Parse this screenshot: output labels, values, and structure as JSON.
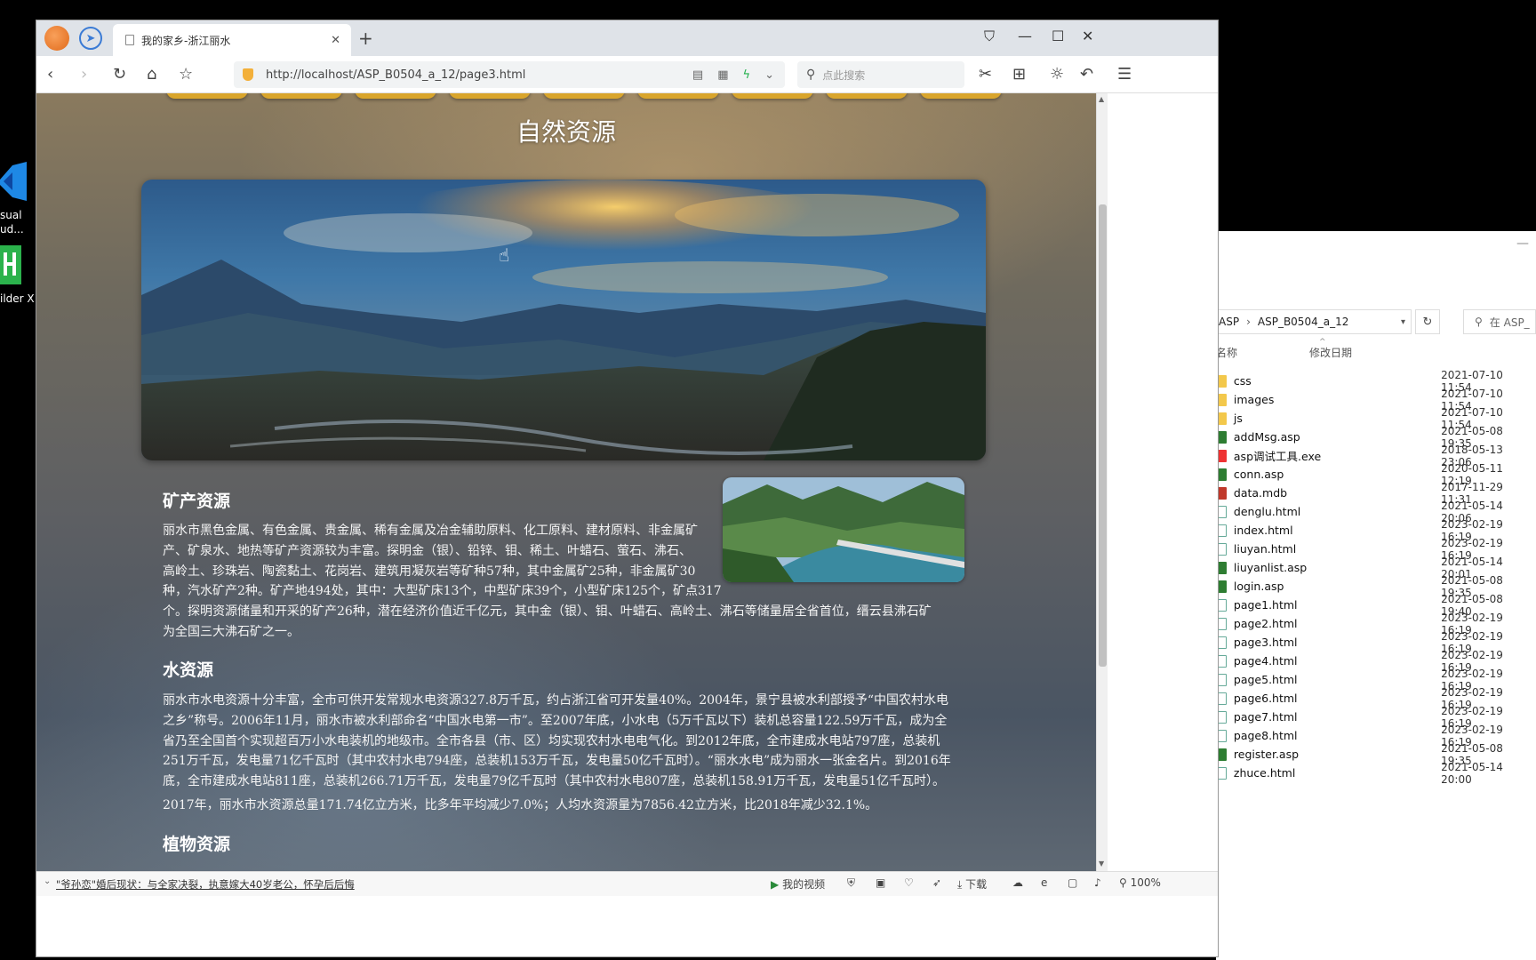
{
  "desktop": {
    "icons": [
      {
        "label_lines": [
          "sual",
          "ud..."
        ]
      },
      {
        "label_lines": [
          "ilder X"
        ]
      }
    ]
  },
  "explorer": {
    "path": [
      "ASP",
      "ASP_B0504_a_12"
    ],
    "search_placeholder": "在 ASP_",
    "col_name": "名称",
    "col_date": "修改日期",
    "files": [
      {
        "name": "css",
        "date": "2021-07-10 11:54",
        "type": "folder"
      },
      {
        "name": "images",
        "date": "2021-07-10 11:54",
        "type": "folder"
      },
      {
        "name": "js",
        "date": "2021-07-10 11:54",
        "type": "folder"
      },
      {
        "name": "addMsg.asp",
        "date": "2021-05-08 19:35",
        "type": "asp"
      },
      {
        "name": "asp调试工具.exe",
        "date": "2018-05-13 23:06",
        "type": "exe"
      },
      {
        "name": "conn.asp",
        "date": "2020-05-11 12:19",
        "type": "asp"
      },
      {
        "name": "data.mdb",
        "date": "2017-11-29 11:31",
        "type": "mdb"
      },
      {
        "name": "denglu.html",
        "date": "2021-05-14 20:06",
        "type": "html"
      },
      {
        "name": "index.html",
        "date": "2023-02-19 16:19",
        "type": "html"
      },
      {
        "name": "liuyan.html",
        "date": "2023-02-19 16:19",
        "type": "html"
      },
      {
        "name": "liuyanlist.asp",
        "date": "2021-05-14 20:01",
        "type": "asp"
      },
      {
        "name": "login.asp",
        "date": "2021-05-08 19:35",
        "type": "asp"
      },
      {
        "name": "page1.html",
        "date": "2021-05-08 19:40",
        "type": "html"
      },
      {
        "name": "page2.html",
        "date": "2023-02-19 16:19",
        "type": "html"
      },
      {
        "name": "page3.html",
        "date": "2023-02-19 16:19",
        "type": "html"
      },
      {
        "name": "page4.html",
        "date": "2023-02-19 16:19",
        "type": "html"
      },
      {
        "name": "page5.html",
        "date": "2023-02-19 16:19",
        "type": "html"
      },
      {
        "name": "page6.html",
        "date": "2023-02-19 16:19",
        "type": "html"
      },
      {
        "name": "page7.html",
        "date": "2023-02-19 16:19",
        "type": "html"
      },
      {
        "name": "page8.html",
        "date": "2023-02-19 16:19",
        "type": "html"
      },
      {
        "name": "register.asp",
        "date": "2021-05-08 19:35",
        "type": "asp"
      },
      {
        "name": "zhuce.html",
        "date": "2021-05-14 20:00",
        "type": "html"
      }
    ]
  },
  "browser": {
    "tab_title": "我的家乡-浙江丽水",
    "url": "http://localhost/ASP_B0504_a_12/page3.html",
    "search_placeholder": "点此搜索",
    "status_news": "\"爷孙恋\"婚后现状：与全家决裂，执意嫁大40岁老公，怀孕后后悔",
    "status_video": "我的视频",
    "status_download": "下载",
    "status_zoom": "100%"
  },
  "page": {
    "title": "自然资源",
    "sections": [
      {
        "heading": "矿产资源",
        "lines": [
          "丽水市黑色金属、有色金属、贵金属、稀有金属及冶金辅助原料、化工原料、建材原料、非金属矿",
          "产、矿泉水、地热等矿产资源较为丰富。探明金（银）、铅锌、钼、稀土、叶蜡石、萤石、沸石、",
          "高岭土、珍珠岩、陶瓷黏土、花岗岩、建筑用凝灰岩等矿种57种，其中金属矿25种，非金属矿30",
          "种，汽水矿产2种。矿产地494处，其中：大型矿床13个，中型矿床39个，小型矿床125个，矿点317",
          "个。探明资源储量和开采的矿产26种，潜在经济价值近千亿元，其中金（银）、钼、叶蜡石、高岭土、沸石等储量居全省首位，缙云县沸石矿",
          "为全国三大沸石矿之一。"
        ]
      },
      {
        "heading": "水资源",
        "lines": [
          "丽水市水电资源十分丰富，全市可供开发常规水电资源327.8万千瓦，约占浙江省可开发量40%。2004年，景宁县被水利部授予“中国农村水电",
          "之乡”称号。2006年11月，丽水市被水利部命名“中国水电第一市”。至2007年底，小水电（5万千瓦以下）装机总容量122.59万千瓦，成为全",
          "省乃至全国首个实现超百万小水电装机的地级市。全市各县（市、区）均实现农村水电电气化。到2012年底，全市建成水电站797座，总装机",
          "251万千瓦，发电量71亿千瓦时（其中农村水电794座，总装机153万千瓦，发电量50亿千瓦时）。“丽水水电”成为丽水一张金名片。到2016年",
          "底，全市建成水电站811座，总装机266.71万千瓦，发电量79亿千瓦时（其中农村水电807座，总装机158.91万千瓦，发电量51亿千瓦时）。",
          "2017年，丽水市水资源总量171.74亿立方米，比多年平均减少7.0%；人均水资源量为7856.42立方米，比2018年减少32.1%。"
        ]
      },
      {
        "heading": "植物资源",
        "lines": []
      }
    ]
  }
}
